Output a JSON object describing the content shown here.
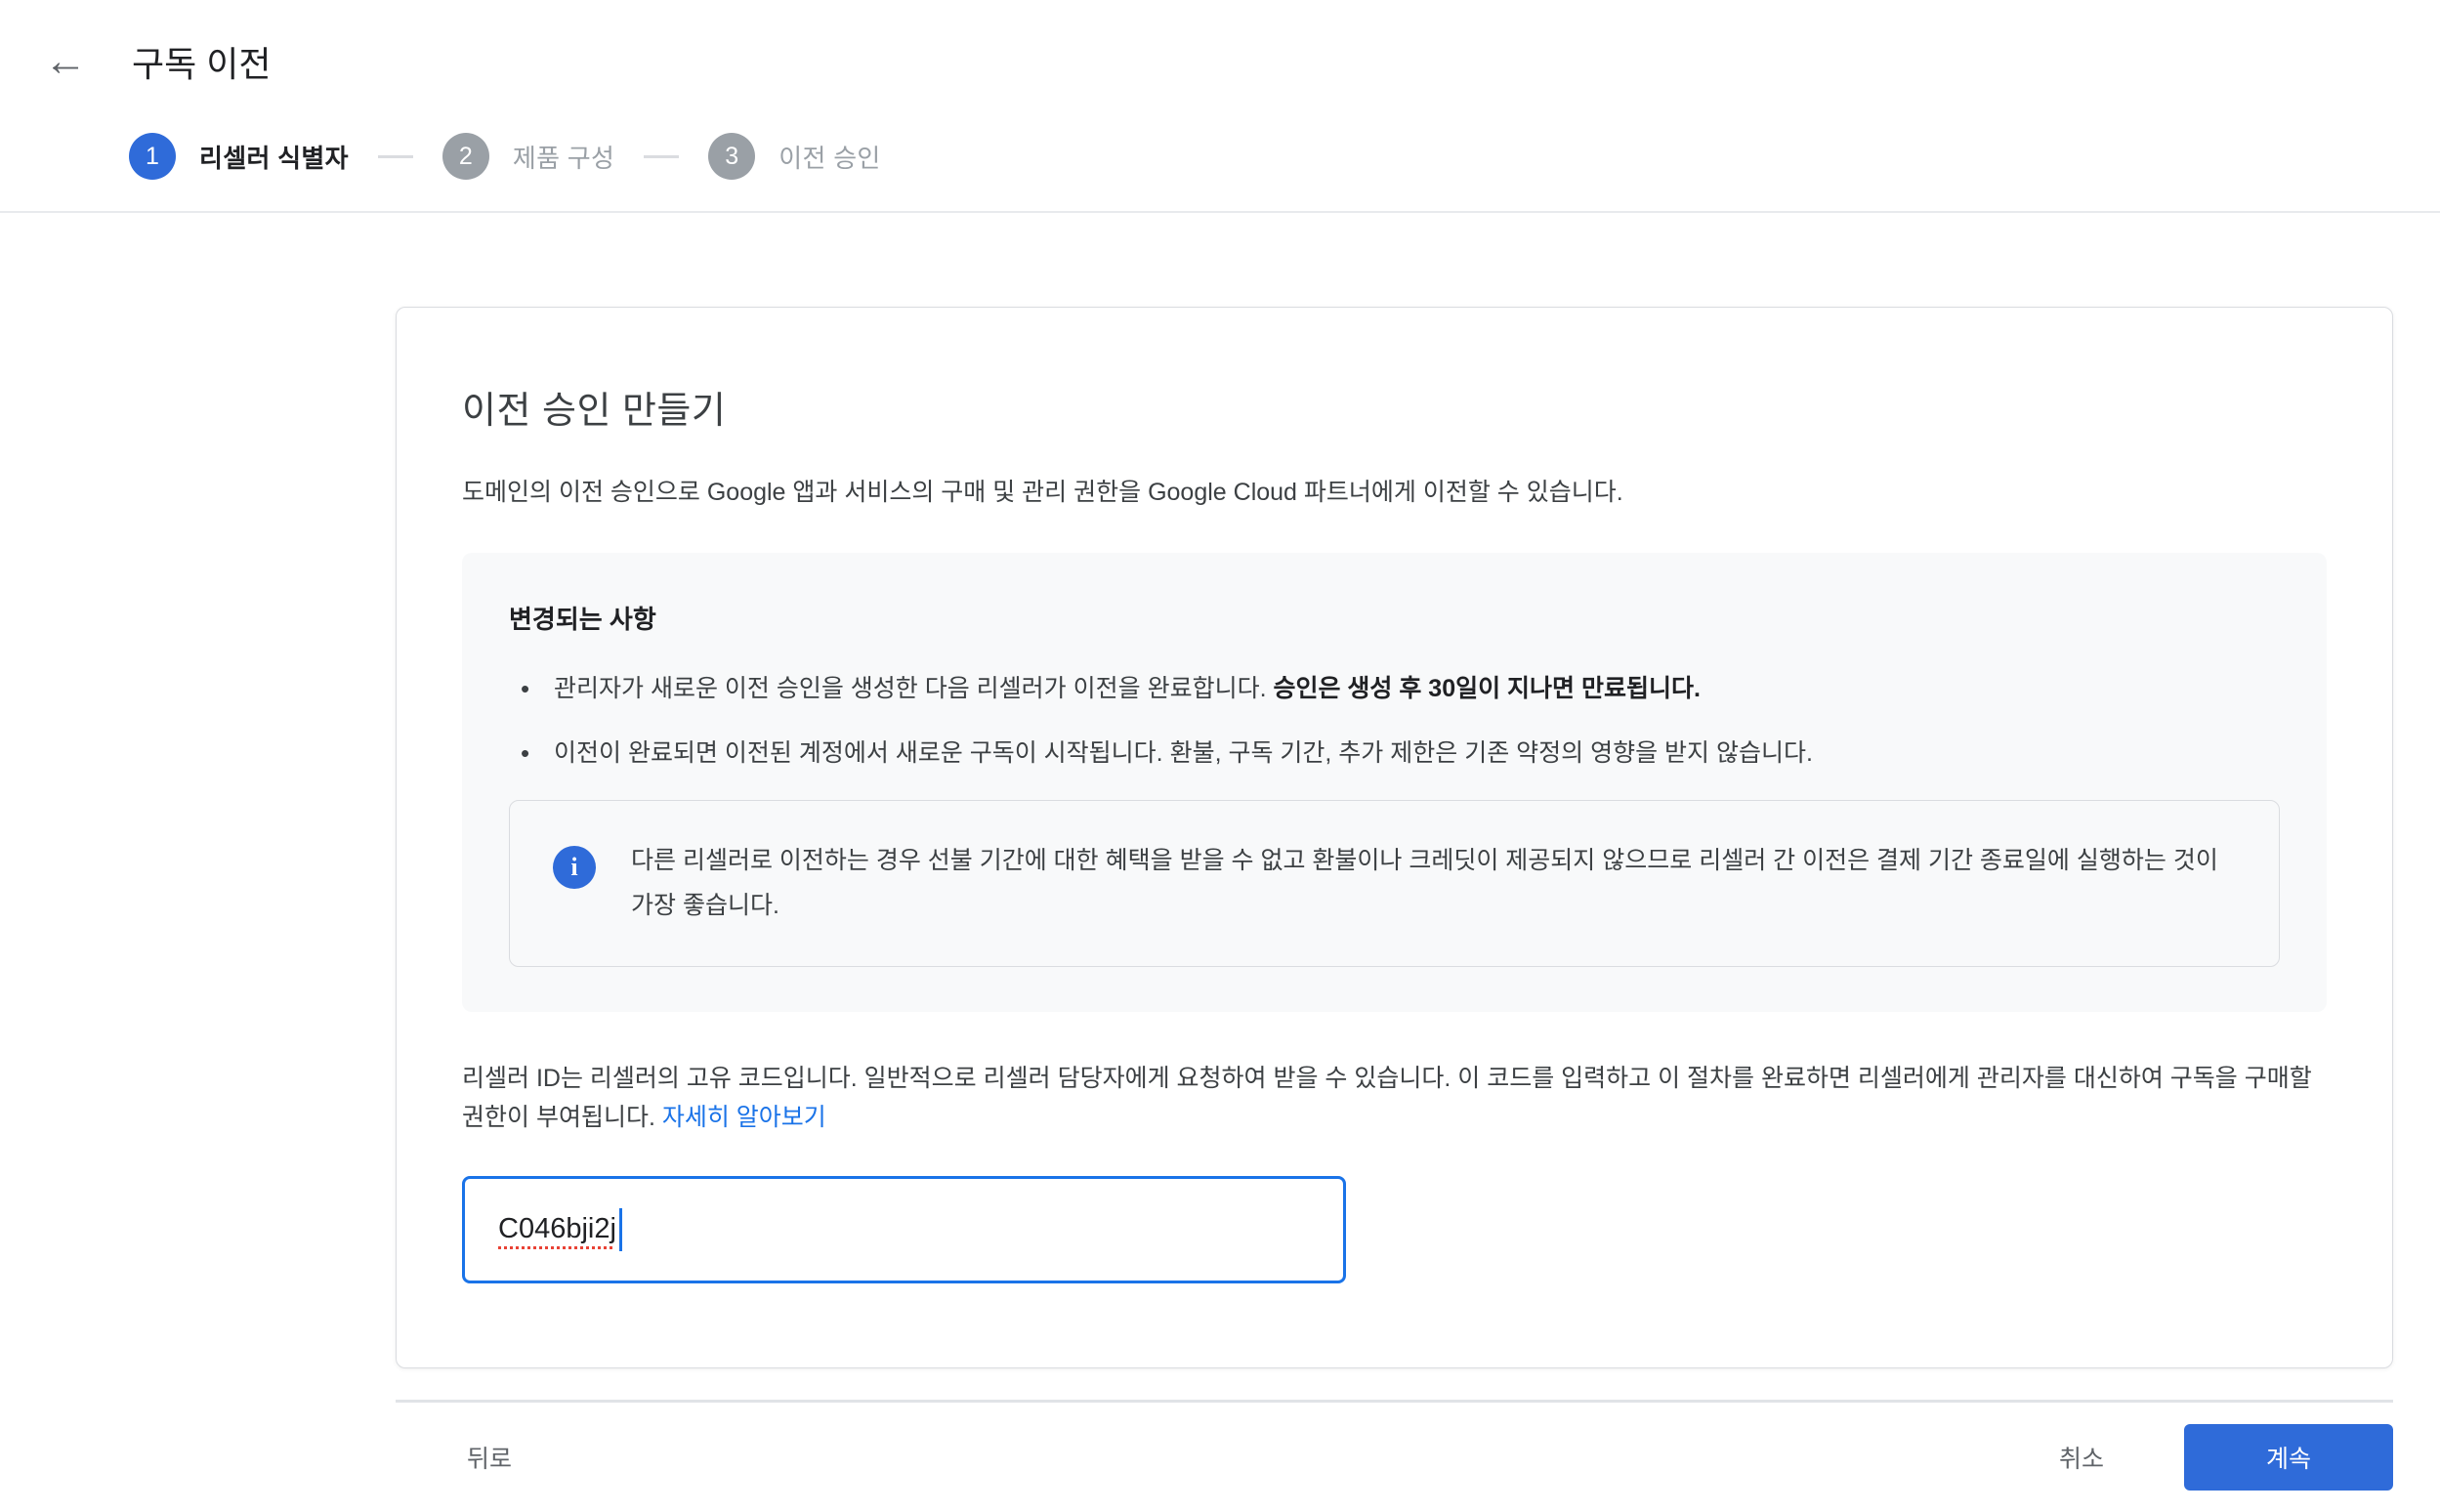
{
  "header": {
    "title": "구독 이전",
    "back_icon": "←"
  },
  "stepper": {
    "steps": [
      {
        "number": "1",
        "label": "리셀러 식별자",
        "state": "active"
      },
      {
        "number": "2",
        "label": "제품 구성",
        "state": "inactive"
      },
      {
        "number": "3",
        "label": "이전 승인",
        "state": "inactive"
      }
    ]
  },
  "card": {
    "title": "이전 승인 만들기",
    "description": "도메인의 이전 승인으로 Google 앱과 서비스의 구매 및 관리 권한을 Google Cloud 파트너에게 이전할 수 있습니다.",
    "changes_panel": {
      "heading": "변경되는 사항",
      "bullet1_normal": "관리자가 새로운 이전 승인을 생성한 다음 리셀러가 이전을 완료합니다. ",
      "bullet1_bold": "승인은 생성 후 30일이 지나면 만료됩니다.",
      "bullet2": "이전이 완료되면 이전된 계정에서 새로운 구독이 시작됩니다. 환불, 구독 기간, 추가 제한은 기존 약정의 영향을 받지 않습니다.",
      "info_icon": "i",
      "info_note": "다른 리셀러로 이전하는 경우 선불 기간에 대한 혜택을 받을 수 없고 환불이나 크레딧이 제공되지 않으므로 리셀러 간 이전은 결제 기간 종료일에 실행하는 것이 가장 좋습니다."
    },
    "reseller_id_text": "리셀러 ID는 리셀러의 고유 코드입니다. 일반적으로 리셀러 담당자에게 요청하여 받을 수 있습니다. 이 코드를 입력하고 이 절차를 완료하면 리셀러에게 관리자를 대신하여 구독을 구매할 권한이 부여됩니다. ",
    "learn_more_label": "자세히 알아보기",
    "reseller_id_input": {
      "value": "C046bji2j"
    }
  },
  "footer": {
    "back_label": "뒤로",
    "cancel_label": "취소",
    "continue_label": "계속"
  },
  "colors": {
    "accent_blue": "#2f6bd9",
    "link_blue": "#1a73e8",
    "focus_border_blue": "#1a73e8",
    "inactive_gray": "#9aa0a6",
    "panel_background": "#f8f9fa",
    "spellcheck_red": "#e94235"
  }
}
